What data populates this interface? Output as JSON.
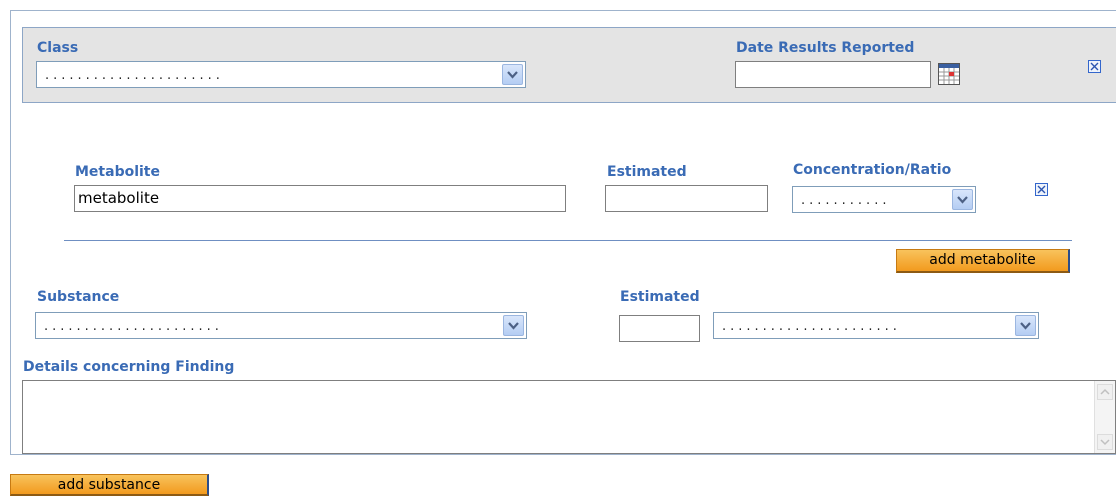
{
  "header": {
    "class_label": "Class",
    "class_value": "......................",
    "date_label": "Date Results Reported",
    "date_value": ""
  },
  "metabolite": {
    "label": "Metabolite",
    "value": "metabolite",
    "estimated_label": "Estimated",
    "estimated_value": "",
    "conc_label": "Concentration/Ratio",
    "conc_value": "...........",
    "add_button": "add metabolite"
  },
  "substance": {
    "label": "Substance",
    "value": "......................",
    "estimated_label": "Estimated",
    "estimated_value": "",
    "unit_value": "......................"
  },
  "details": {
    "label": "Details concerning Finding",
    "value": ""
  },
  "footer": {
    "add_button": "add substance"
  },
  "colors": {
    "label_blue": "#3a6bb5",
    "button_orange": "#f29a1e"
  }
}
